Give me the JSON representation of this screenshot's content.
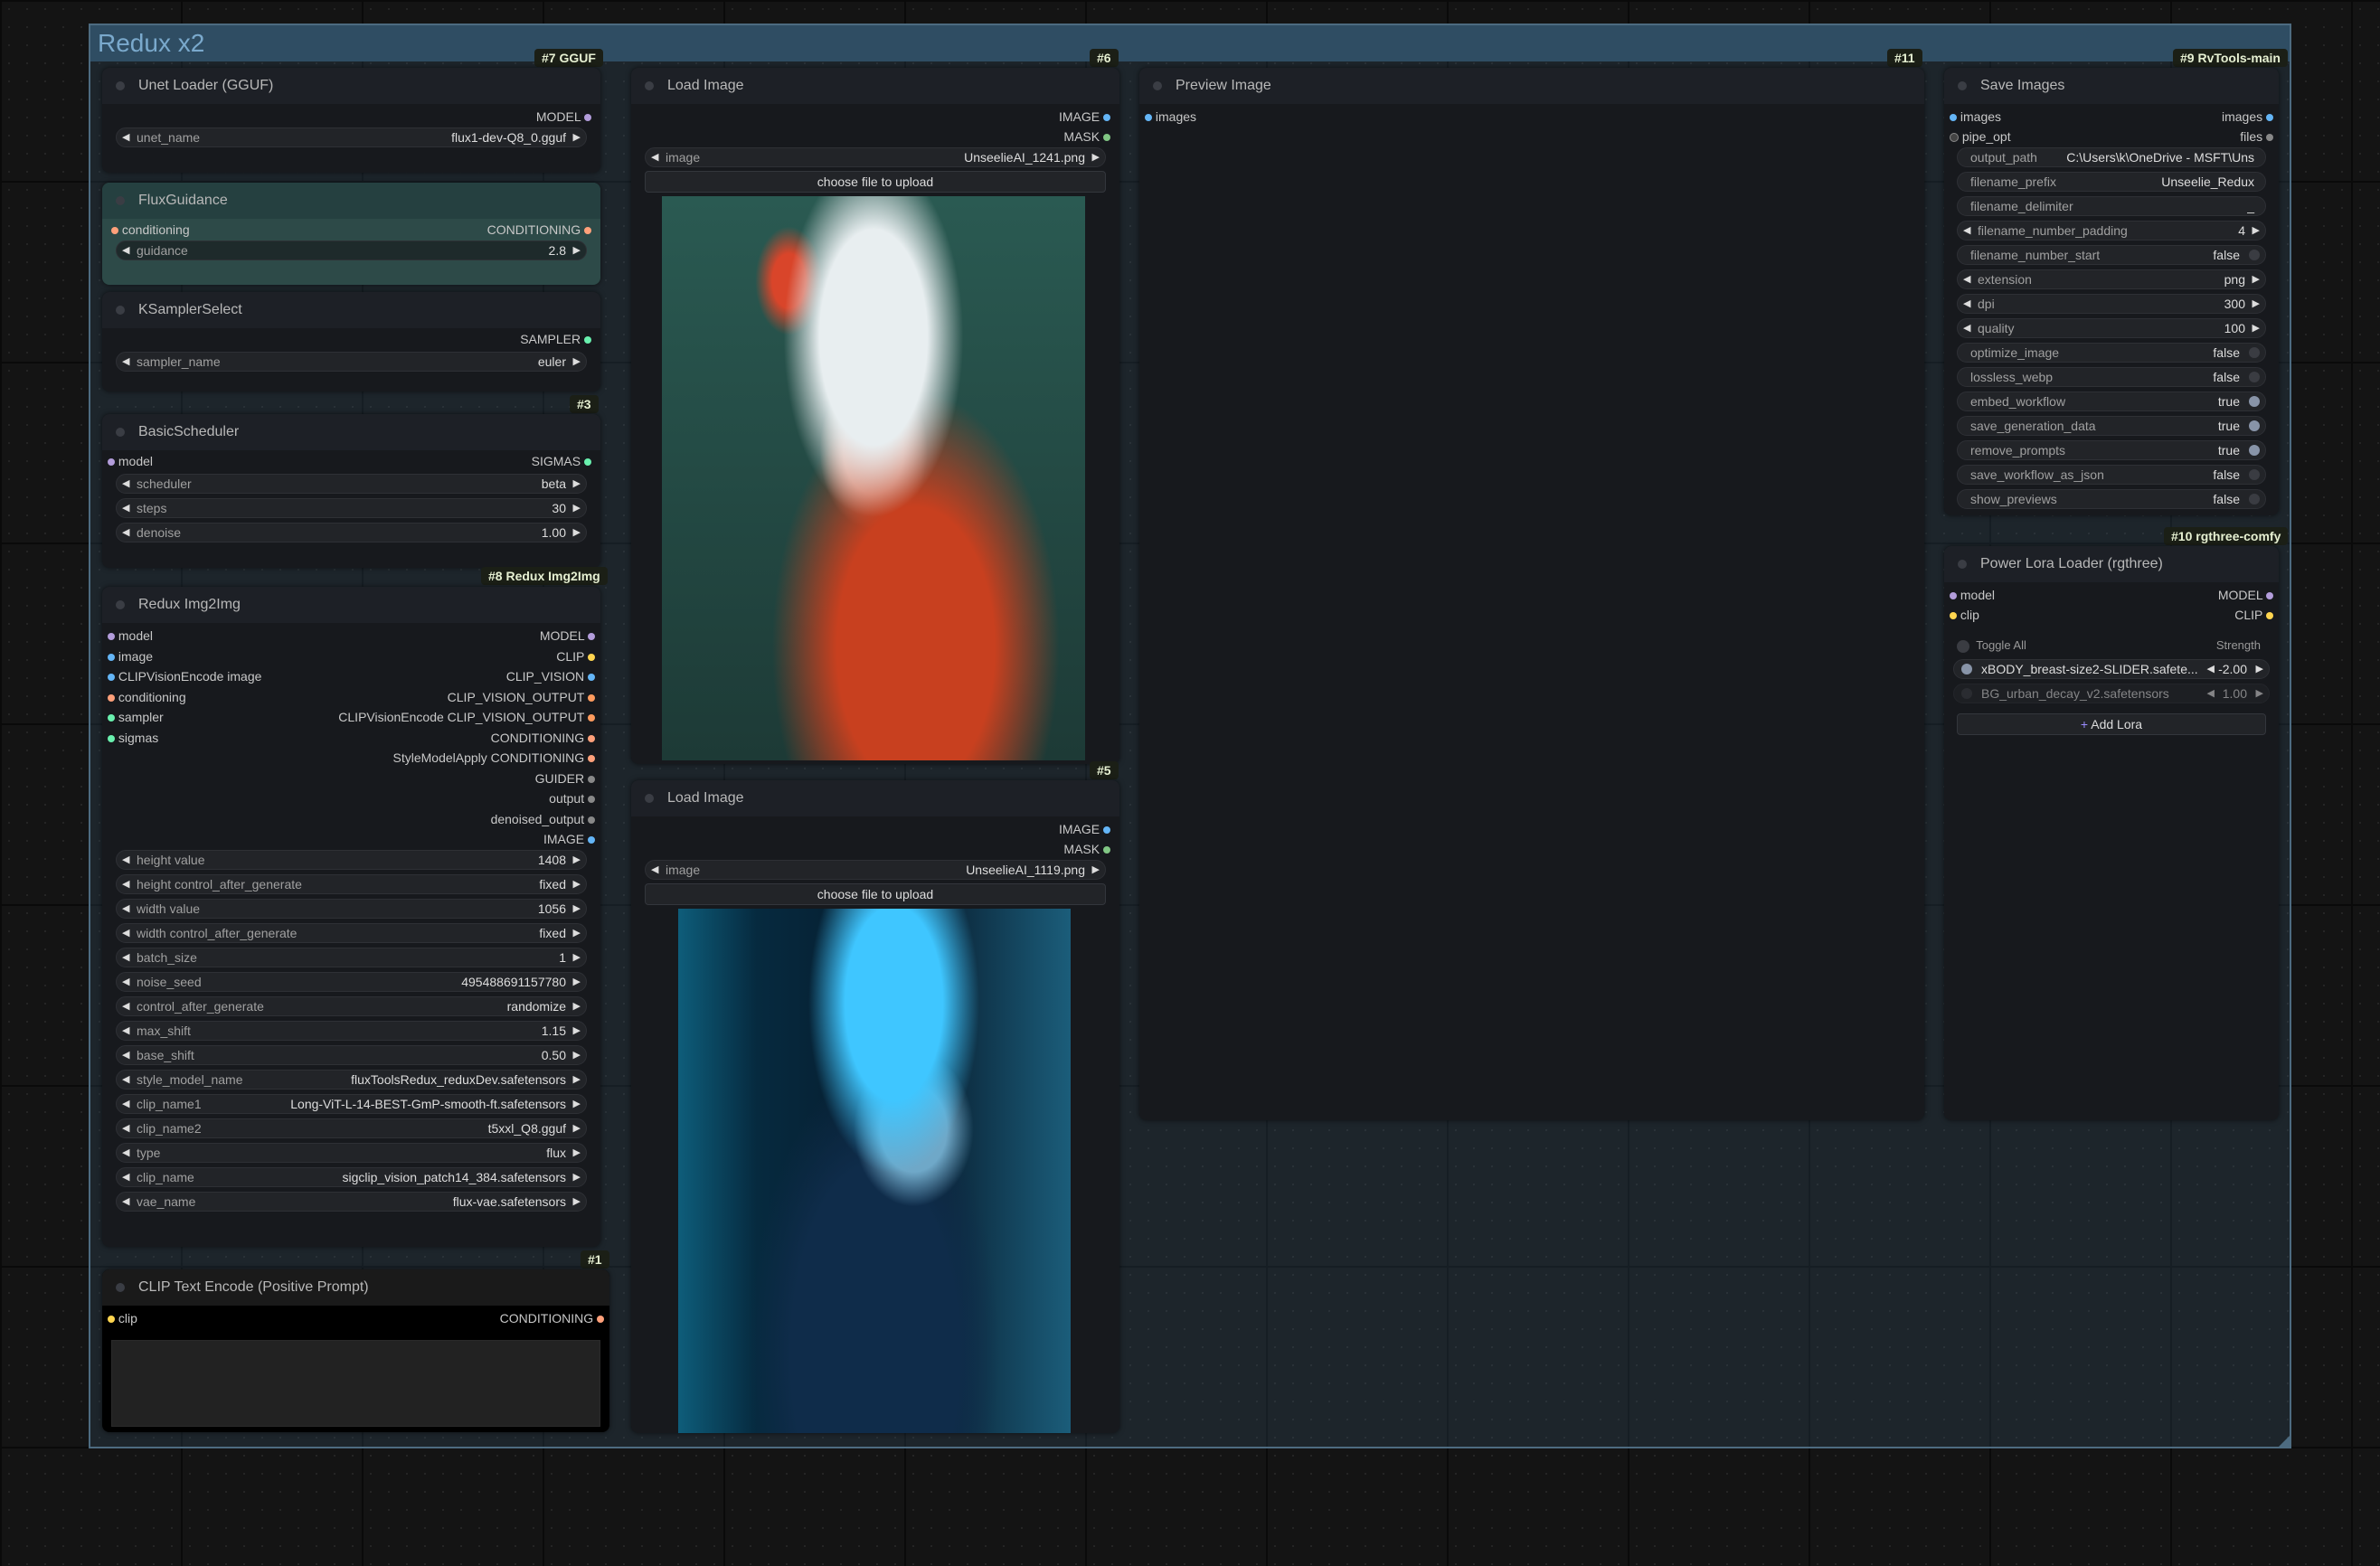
{
  "group": {
    "title": "Redux x2"
  },
  "nodes": {
    "unet": {
      "badge": "#7 GGUF",
      "title": "Unet Loader (GGUF)",
      "out": "MODEL",
      "widget": {
        "label": "unet_name",
        "value": "flux1-dev-Q8_0.gguf"
      }
    },
    "flux": {
      "title": "FluxGuidance",
      "in": "conditioning",
      "out": "CONDITIONING",
      "widget": {
        "label": "guidance",
        "value": "2.8"
      }
    },
    "ksampler": {
      "title": "KSamplerSelect",
      "out": "SAMPLER",
      "widget": {
        "label": "sampler_name",
        "value": "euler"
      }
    },
    "sched": {
      "badge": "#3",
      "title": "BasicScheduler",
      "in": "model",
      "out": "SIGMAS",
      "widgets": [
        {
          "label": "scheduler",
          "value": "beta"
        },
        {
          "label": "steps",
          "value": "30"
        },
        {
          "label": "denoise",
          "value": "1.00"
        }
      ]
    },
    "redux": {
      "badge": "#8 Redux Img2Img",
      "title": "Redux Img2Img",
      "inputs": [
        "model",
        "image",
        "CLIPVisionEncode image",
        "conditioning",
        "sampler",
        "sigmas"
      ],
      "outputs": [
        "MODEL",
        "CLIP",
        "CLIP_VISION",
        "CLIP_VISION_OUTPUT",
        "CLIPVisionEncode CLIP_VISION_OUTPUT",
        "CONDITIONING",
        "StyleModelApply CONDITIONING",
        "GUIDER",
        "output",
        "denoised_output",
        "IMAGE"
      ],
      "widgets": [
        {
          "label": "height value",
          "value": "1408"
        },
        {
          "label": "height control_after_generate",
          "value": "fixed"
        },
        {
          "label": "width value",
          "value": "1056"
        },
        {
          "label": "width control_after_generate",
          "value": "fixed"
        },
        {
          "label": "batch_size",
          "value": "1"
        },
        {
          "label": "noise_seed",
          "value": "495488691157780"
        },
        {
          "label": "control_after_generate",
          "value": "randomize"
        },
        {
          "label": "max_shift",
          "value": "1.15"
        },
        {
          "label": "base_shift",
          "value": "0.50"
        },
        {
          "label": "style_model_name",
          "value": "fluxToolsRedux_reduxDev.safetensors"
        },
        {
          "label": "clip_name1",
          "value": "Long-ViT-L-14-BEST-GmP-smooth-ft.safetensors"
        },
        {
          "label": "clip_name2",
          "value": "t5xxl_Q8.gguf"
        },
        {
          "label": "type",
          "value": "flux"
        },
        {
          "label": "clip_name",
          "value": "sigclip_vision_patch14_384.safetensors"
        },
        {
          "label": "vae_name",
          "value": "flux-vae.safetensors"
        }
      ]
    },
    "clip": {
      "badge": "#1",
      "title": "CLIP Text Encode (Positive Prompt)",
      "in": "clip",
      "out": "CONDITIONING"
    },
    "load1": {
      "badge": "#6",
      "title": "Load Image",
      "outs": [
        "IMAGE",
        "MASK"
      ],
      "widget": {
        "label": "image",
        "value": "UnseelieAI_1241.png"
      },
      "upload": "choose file to upload"
    },
    "load2": {
      "badge": "#5",
      "title": "Load Image",
      "outs": [
        "IMAGE",
        "MASK"
      ],
      "widget": {
        "label": "image",
        "value": "UnseelieAI_1119.png"
      },
      "upload": "choose file to upload"
    },
    "preview": {
      "badge": "#11",
      "title": "Preview Image",
      "in": "images"
    },
    "save": {
      "badge": "#9 RvTools-main",
      "title": "Save Images",
      "ins": [
        "images",
        "pipe_opt"
      ],
      "outs": [
        "images",
        "files"
      ],
      "widgets": [
        {
          "label": "output_path",
          "value": "C:\\Users\\k\\OneDrive - MSFT\\Uns",
          "kind": "text"
        },
        {
          "label": "filename_prefix",
          "value": "Unseelie_Redux",
          "kind": "text"
        },
        {
          "label": "filename_delimiter",
          "value": "_",
          "kind": "text"
        },
        {
          "label": "filename_number_padding",
          "value": "4",
          "kind": "num"
        },
        {
          "label": "filename_number_start",
          "value": "false",
          "kind": "toggle"
        },
        {
          "label": "extension",
          "value": "png",
          "kind": "num"
        },
        {
          "label": "dpi",
          "value": "300",
          "kind": "num"
        },
        {
          "label": "quality",
          "value": "100",
          "kind": "num"
        },
        {
          "label": "optimize_image",
          "value": "false",
          "kind": "toggle"
        },
        {
          "label": "lossless_webp",
          "value": "false",
          "kind": "toggle"
        },
        {
          "label": "embed_workflow",
          "value": "true",
          "kind": "toggle"
        },
        {
          "label": "save_generation_data",
          "value": "true",
          "kind": "toggle"
        },
        {
          "label": "remove_prompts",
          "value": "true",
          "kind": "toggle"
        },
        {
          "label": "save_workflow_as_json",
          "value": "false",
          "kind": "toggle"
        },
        {
          "label": "show_previews",
          "value": "false",
          "kind": "toggle"
        }
      ]
    },
    "lora": {
      "badge": "#10 rgthree-comfy",
      "title": "Power Lora Loader (rgthree)",
      "ins": [
        "model",
        "clip"
      ],
      "outs": [
        "MODEL",
        "CLIP"
      ],
      "toggle_all": "Toggle All",
      "strength": "Strength",
      "loras": [
        {
          "name": "xBODY_breast-size2-SLIDER.safete...",
          "value": "-2.00",
          "on": true
        },
        {
          "name": "BG_urban_decay_v2.safetensors",
          "value": "1.00",
          "on": false
        }
      ],
      "add": "Add Lora"
    }
  },
  "colors": {
    "model": "#b39ddb",
    "image": "#64b5f6",
    "clip": "#ffd54f",
    "conditioning": "#ffa07a",
    "sampler": "#69f0ae",
    "sigmas": "#69f0ae",
    "mask": "#81c784"
  },
  "arrows": {
    "left": "◀",
    "right": "▶"
  },
  "icons": {
    "add": "plus-icon"
  }
}
